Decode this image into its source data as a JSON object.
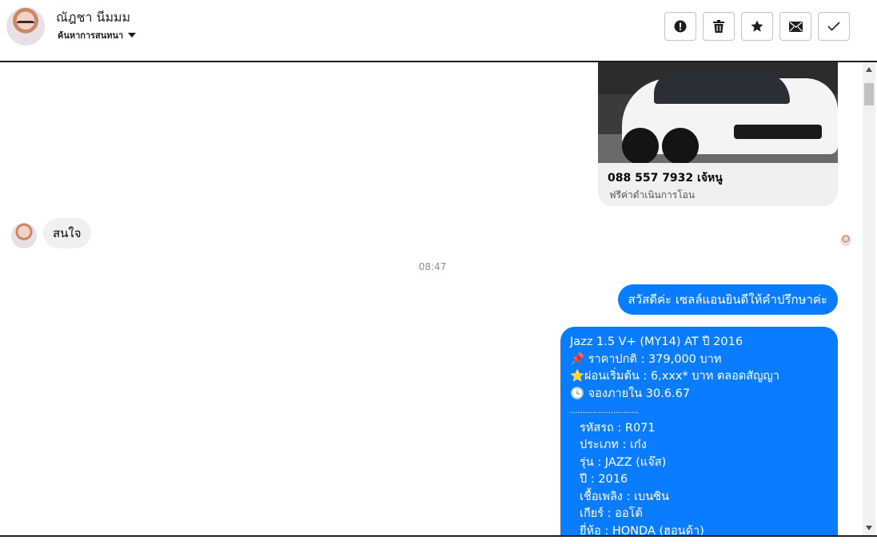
{
  "header": {
    "contact_name": "ณัฎชา นีมมม",
    "manage_label": "ค้นหาการสนทนา",
    "toolbar_icons": [
      "alert-icon",
      "trash-icon",
      "star-icon",
      "mail-icon",
      "check-icon"
    ]
  },
  "card": {
    "title": "088 557 7932 เจ้หนู",
    "subtitle": "ฟรีค่าดำเนินการโอน"
  },
  "incoming": {
    "text": "สนใจ"
  },
  "timestamp": "08:47",
  "outgoing": {
    "greeting": "สวัสดีค่ะ เซลล์แอนยินดีให้คำปรึกษาค่ะ",
    "details": [
      "Jazz 1.5 V+ (MY14) AT ปี 2016",
      "📌 ราคาปกติ : 379,000 บาท",
      "⭐ผ่อนเริ่มต้น : 6,xxx* บาท ตลอดสัญญา",
      "🕓 จองภายใน 30.6.67",
      "...........................",
      "รหัสรถ : R071",
      "ประเภท : เก๋ง",
      "รุ่น : JAZZ (แจ๊ส)",
      "ปี : 2016",
      "เชื้อเพลิง : เบนซิน",
      "เกียร์ : ออโต้",
      "ยี่ห้อ : HONDA (ฮอนด้า)"
    ]
  },
  "colors": {
    "accent": "#0a7cff",
    "incoming_bubble": "#f0f0f0"
  }
}
